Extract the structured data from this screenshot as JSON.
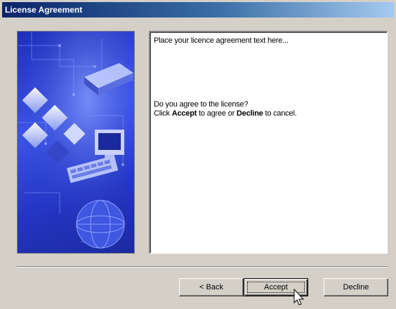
{
  "window": {
    "title": "License Agreement"
  },
  "license_text": {
    "placeholder_line": "Place your licence agreement text here...",
    "question": "Do you agree to the license?",
    "instruction_prefix": "Click ",
    "accept_word": "Accept",
    "instruction_middle": " to agree or ",
    "decline_word": "Decline",
    "instruction_suffix": " to cancel."
  },
  "buttons": {
    "back_label": "< Back",
    "accept_label": "Accept",
    "decline_label": "Decline"
  },
  "icons": {
    "cursor": "pointer-hand-icon",
    "side_image": "circuit-board-artwork"
  },
  "colors": {
    "titlebar_start": "#0a246a",
    "titlebar_end": "#a6caf0",
    "dialog_face": "#d4d0c8",
    "artwork_blue": "#2f45d8"
  }
}
